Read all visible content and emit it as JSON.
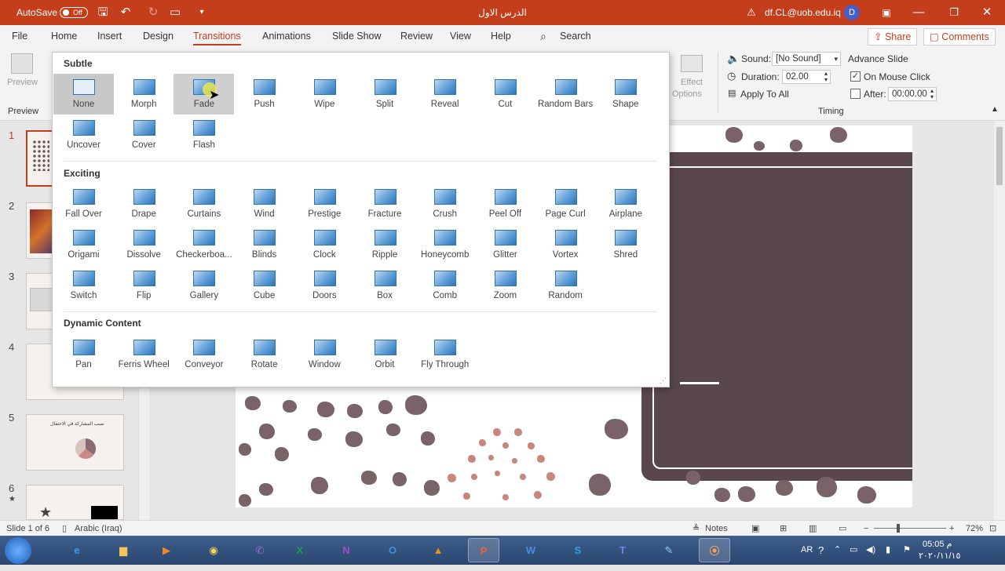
{
  "titlebar": {
    "autosave_label": "AutoSave",
    "autosave_state": "Off",
    "doc_title": "الدرس الاول بوربوينت",
    "warning_icon": "warning-icon",
    "account_email": "df.CL@uob.edu.iq",
    "avatar_letter": "D",
    "color": "#c43e1c"
  },
  "tabs": [
    {
      "label": "File"
    },
    {
      "label": "Home"
    },
    {
      "label": "Insert"
    },
    {
      "label": "Design"
    },
    {
      "label": "Transitions"
    },
    {
      "label": "Animations"
    },
    {
      "label": "Slide Show"
    },
    {
      "label": "Review"
    },
    {
      "label": "View"
    },
    {
      "label": "Help"
    }
  ],
  "search": {
    "label": "Search"
  },
  "share": {
    "label": "Share"
  },
  "comments": {
    "label": "Comments"
  },
  "ribbon": {
    "preview_label": "Preview",
    "preview_group": "Preview",
    "effect_options_line1": "Effect",
    "effect_options_line2": "Options",
    "sound_label": "Sound:",
    "sound_value": "[No Sound]",
    "duration_label": "Duration:",
    "duration_value": "02.00",
    "apply_all": "Apply To All",
    "advance_slide": "Advance Slide",
    "on_mouse_click": "On Mouse Click",
    "on_mouse_click_checked": true,
    "after_label": "After:",
    "after_value": "00:00.00",
    "after_checked": false,
    "timing_group": "Timing"
  },
  "gallery": {
    "subtle_header": "Subtle",
    "subtle": [
      "None",
      "Morph",
      "Fade",
      "Push",
      "Wipe",
      "Split",
      "Reveal",
      "Cut",
      "Random Bars",
      "Shape",
      "Uncover",
      "Cover",
      "Flash"
    ],
    "exciting_header": "Exciting",
    "exciting": [
      "Fall Over",
      "Drape",
      "Curtains",
      "Wind",
      "Prestige",
      "Fracture",
      "Crush",
      "Peel Off",
      "Page Curl",
      "Airplane",
      "Origami",
      "Dissolve",
      "Checkerboa...",
      "Blinds",
      "Clock",
      "Ripple",
      "Honeycomb",
      "Glitter",
      "Vortex",
      "Shred",
      "Switch",
      "Flip",
      "Gallery",
      "Cube",
      "Doors",
      "Box",
      "Comb",
      "Zoom",
      "Random"
    ],
    "dynamic_header": "Dynamic Content",
    "dynamic": [
      "Pan",
      "Ferris Wheel",
      "Conveyor",
      "Rotate",
      "Window",
      "Orbit",
      "Fly Through"
    ],
    "selected": "None",
    "hovered": "Fade",
    "accent": "#2e75b6"
  },
  "thumbnails": {
    "numbers": [
      "1",
      "2",
      "3",
      "4",
      "5",
      "6"
    ],
    "slide5_title": "نسب المشاركة في الاحتفال",
    "active": "1"
  },
  "statusbar": {
    "slide_info": "Slide 1 of 6",
    "language": "Arabic (Iraq)",
    "notes": "Notes",
    "zoom": "72%"
  },
  "taskbar": {
    "apps": [
      "ie-icon",
      "explorer-icon",
      "media-player-icon",
      "chrome-icon",
      "viber-icon",
      "excel-icon",
      "onenote-icon",
      "outlook-icon",
      "vlc-icon",
      "powerpoint-icon",
      "word-icon",
      "skype-icon",
      "teams-icon",
      "paint-icon",
      "recorder-icon"
    ],
    "lang": "AR",
    "time": "05:05 م",
    "date": "٢٠٢٠/١١/١٥"
  }
}
